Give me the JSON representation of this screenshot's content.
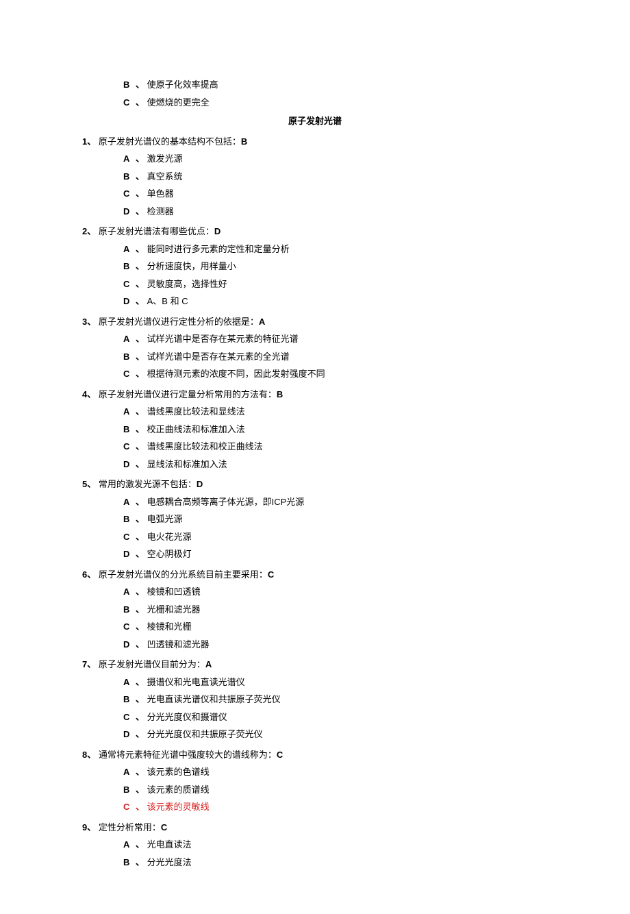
{
  "intro_options": [
    {
      "label": "B",
      "text": "使原子化效率提高"
    },
    {
      "label": "C",
      "text": "使燃烧的更完全"
    }
  ],
  "section_title": "原子发射光谱",
  "questions": [
    {
      "num": "1",
      "sep": "、",
      "text": "原子发射光谱仪的基本结构不包括：",
      "answer": "B",
      "options": [
        {
          "label": "A",
          "text": "激发光源"
        },
        {
          "label": "B",
          "text": "真空系统"
        },
        {
          "label": "C",
          "text": "单色器"
        },
        {
          "label": "D",
          "text": "检测器"
        }
      ]
    },
    {
      "num": "2",
      "sep": "、",
      "text": "原子发射光谱法有哪些优点：",
      "answer": "D",
      "options": [
        {
          "label": "A",
          "text": "能同时进行多元素的定性和定量分析"
        },
        {
          "label": "B",
          "text": "分析速度快，用样量小"
        },
        {
          "label": "C",
          "text": "灵敏度高，选择性好"
        },
        {
          "label": "D",
          "text": "A、B 和 C"
        }
      ]
    },
    {
      "num": "3",
      "sep": "、",
      "text": "原子发射光谱仪进行定性分析的依据是：",
      "answer": "A",
      "options": [
        {
          "label": "A",
          "text": "试样光谱中是否存在某元素的特征光谱"
        },
        {
          "label": "B",
          "text": "试样光谱中是否存在某元素的全光谱"
        },
        {
          "label": "C",
          "text": "根据待测元素的浓度不同，因此发射强度不同"
        }
      ]
    },
    {
      "num": "4",
      "sep": "、",
      "text": "原子发射光谱仪进行定量分析常用的方法有：",
      "answer": "B",
      "options": [
        {
          "label": "A",
          "text": "谱线黑度比较法和显线法"
        },
        {
          "label": "B",
          "text": "校正曲线法和标准加入法"
        },
        {
          "label": "C",
          "text": "谱线黑度比较法和校正曲线法"
        },
        {
          "label": "D",
          "text": "显线法和标准加入法"
        }
      ]
    },
    {
      "num": "5",
      "sep": "、",
      "text": "常用的激发光源不包括：",
      "answer": "D",
      "options": [
        {
          "label": "A",
          "text": "电感耦合高频等离子体光源，即ICP光源"
        },
        {
          "label": "B",
          "text": "电弧光源"
        },
        {
          "label": "C",
          "text": "电火花光源"
        },
        {
          "label": "D",
          "text": "空心阴极灯"
        }
      ]
    },
    {
      "num": "6",
      "sep": "、",
      "text": "原子发射光谱仪的分光系统目前主要采用：",
      "answer": "C",
      "options": [
        {
          "label": "A",
          "text": "棱镜和凹透镜"
        },
        {
          "label": "B",
          "text": "光栅和滤光器"
        },
        {
          "label": "C",
          "text": "棱镜和光栅"
        },
        {
          "label": "D",
          "text": "凹透镜和滤光器"
        }
      ]
    },
    {
      "num": "7",
      "sep": "、",
      "text": "原子发射光谱仪目前分为：",
      "answer": "A",
      "options": [
        {
          "label": "A",
          "text": "摄谱仪和光电直读光谱仪"
        },
        {
          "label": "B",
          "text": "光电直读光谱仪和共振原子荧光仪"
        },
        {
          "label": "C",
          "text": "分光光度仪和摄谱仪"
        },
        {
          "label": "D",
          "text": "分光光度仪和共振原子荧光仪"
        }
      ]
    },
    {
      "num": "8",
      "sep": "、",
      "text": "通常将元素特征光谱中强度较大的谱线称为：",
      "answer": "C",
      "options": [
        {
          "label": "A",
          "text": "该元素的色谱线"
        },
        {
          "label": "B",
          "text": "该元素的质谱线"
        },
        {
          "label": "C",
          "text": "该元素的灵敏线",
          "highlight": true
        }
      ]
    },
    {
      "num": "9",
      "sep": "、",
      "text": "定性分析常用：",
      "answer": "C",
      "options": [
        {
          "label": "A",
          "text": "光电直读法"
        },
        {
          "label": "B",
          "text": "分光光度法"
        }
      ]
    }
  ]
}
